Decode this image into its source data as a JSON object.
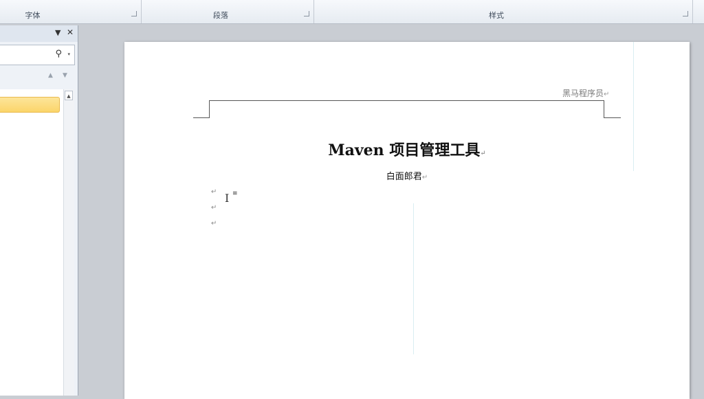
{
  "ribbon": {
    "groups": [
      {
        "label": "字体"
      },
      {
        "label": "段落"
      },
      {
        "label": "样式"
      }
    ]
  },
  "nav_pane": {
    "close": "✕",
    "menu": "▼",
    "search_icon": "search-icon",
    "dropdown": "▾",
    "prev": "▲",
    "next": "▼",
    "scroll_up": "▲"
  },
  "document": {
    "header_text": "黑马程序员",
    "title": "Maven 项目管理工具",
    "author": "白面郎君",
    "paragraph_mark": "↵"
  },
  "colors": {
    "highlight": "#fbd56a",
    "page": "#ffffff",
    "background": "#c9cdd3"
  }
}
